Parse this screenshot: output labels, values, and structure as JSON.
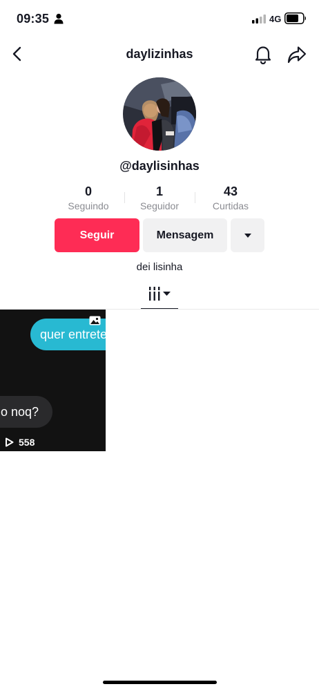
{
  "status_bar": {
    "time": "09:35",
    "network": "4G",
    "icons": [
      "person-icon",
      "signal-icon",
      "battery-icon"
    ]
  },
  "nav": {
    "title": "daylizinhas",
    "icons": [
      "back-icon",
      "bell-icon",
      "share-icon"
    ]
  },
  "profile": {
    "username": "@daylisinhas",
    "stats": [
      {
        "value": "0",
        "label": "Seguindo"
      },
      {
        "value": "1",
        "label": "Seguidor"
      },
      {
        "value": "43",
        "label": "Curtidas"
      }
    ],
    "follow_label": "Seguir",
    "message_label": "Mensagem",
    "more_icon": "caret-down-icon",
    "bio": "dei lisinha"
  },
  "tabs": {
    "active_icon": "grid-icon",
    "dropdown_icon": "caret-down-icon"
  },
  "videos": [
    {
      "bubble_1": "quer entreter",
      "bubble_2": "o noq?",
      "views": "558",
      "icons": [
        "photo-icon",
        "play-icon"
      ]
    }
  ],
  "colors": {
    "accent": "#fe2c55",
    "secondary_button": "#f1f1f2",
    "text": "#161823",
    "muted_text": "#8a8b91",
    "chat_bubble": "#28b9d2"
  }
}
